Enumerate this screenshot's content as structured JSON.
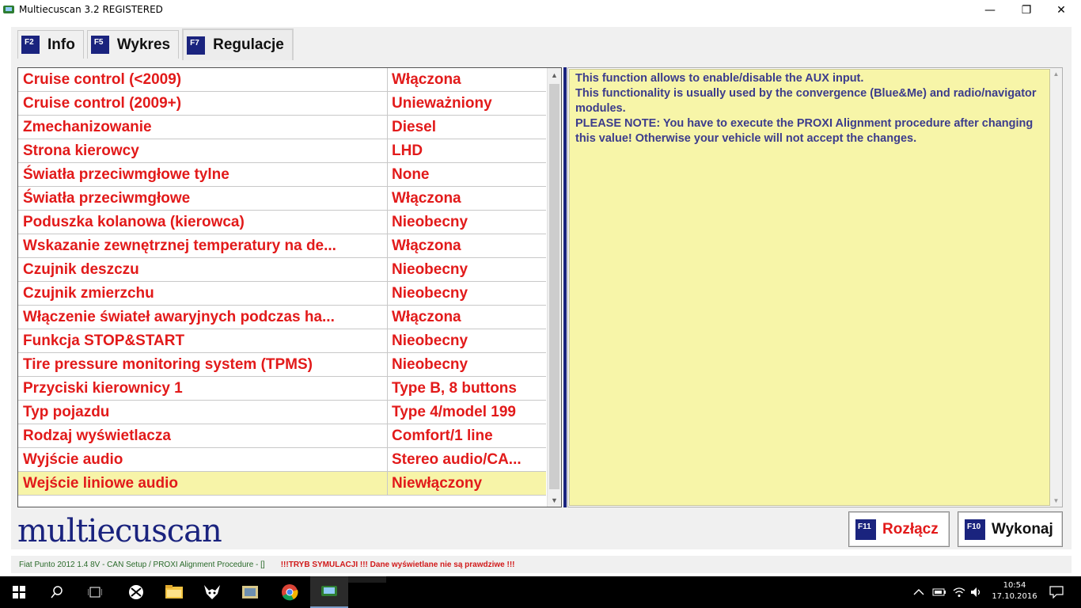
{
  "window": {
    "title": "Multiecuscan 3.2 REGISTERED",
    "minimize_glyph": "—",
    "maximize_glyph": "❐",
    "close_glyph": "✕"
  },
  "tabs": [
    {
      "key": "F2",
      "label": "Info",
      "active": false
    },
    {
      "key": "F5",
      "label": "Wykres",
      "active": false
    },
    {
      "key": "F7",
      "label": "Regulacje",
      "active": true
    }
  ],
  "settings": {
    "rows": [
      {
        "name": "Cruise control (<2009)",
        "value": "Włączona"
      },
      {
        "name": "Cruise control (2009+)",
        "value": "Unieważniony"
      },
      {
        "name": "Zmechanizowanie",
        "value": "Diesel"
      },
      {
        "name": "Strona kierowcy",
        "value": "LHD"
      },
      {
        "name": "Światła przeciwmgłowe tylne",
        "value": "None"
      },
      {
        "name": "Światła przeciwmgłowe",
        "value": "Włączona"
      },
      {
        "name": "Poduszka kolanowa (kierowca)",
        "value": "Nieobecny"
      },
      {
        "name": "Wskazanie zewnętrznej temperatury na de...",
        "value": "Włączona"
      },
      {
        "name": "Czujnik deszczu",
        "value": "Nieobecny"
      },
      {
        "name": "Czujnik zmierzchu",
        "value": "Nieobecny"
      },
      {
        "name": "Włączenie świateł awaryjnych podczas ha...",
        "value": "Włączona"
      },
      {
        "name": "Funkcja STOP&START",
        "value": "Nieobecny"
      },
      {
        "name": "Tire pressure monitoring system (TPMS)",
        "value": "Nieobecny"
      },
      {
        "name": "Przyciski kierownicy 1",
        "value": "Type B, 8 buttons"
      },
      {
        "name": "Typ pojazdu",
        "value": "Type 4/model 199"
      },
      {
        "name": "Rodzaj wyświetlacza",
        "value": "Comfort/1 line"
      },
      {
        "name": "Wyjście audio",
        "value": "Stereo audio/CA..."
      },
      {
        "name": "Wejście liniowe audio",
        "value": "Niewłączony",
        "selected": true
      }
    ]
  },
  "description": {
    "lines": [
      "This function allows to enable/disable the AUX input.",
      "This functionality is usually used by the convergence (Blue&Me) and radio/navigator modules.",
      "PLEASE NOTE: You have to execute the PROXI Alignment procedure after changing this value! Otherwise your vehicle will not accept the changes."
    ]
  },
  "logo": {
    "text": "multiecuscan"
  },
  "buttons": {
    "disconnect": {
      "key": "F11",
      "label": "Rozłącz",
      "color": "#e21a1a"
    },
    "execute": {
      "key": "F10",
      "label": "Wykonaj",
      "color": "#111111"
    }
  },
  "status": {
    "vehicle": "Fiat Punto 2012 1.4 8V - CAN Setup / PROXI Alignment Procedure - []",
    "simulation": "!!!TRYB SYMULACJI !!! Dane wyświetlane nie są prawdziwe !!!"
  },
  "taskbar": {
    "time": "10:54",
    "date": "17.10.2016"
  },
  "colors": {
    "accent": "#1a237e",
    "value_text": "#e21a1a",
    "selected_row": "#f7f4a8",
    "description_bg": "#f7f5a8",
    "description_text": "#3c3c8c"
  }
}
